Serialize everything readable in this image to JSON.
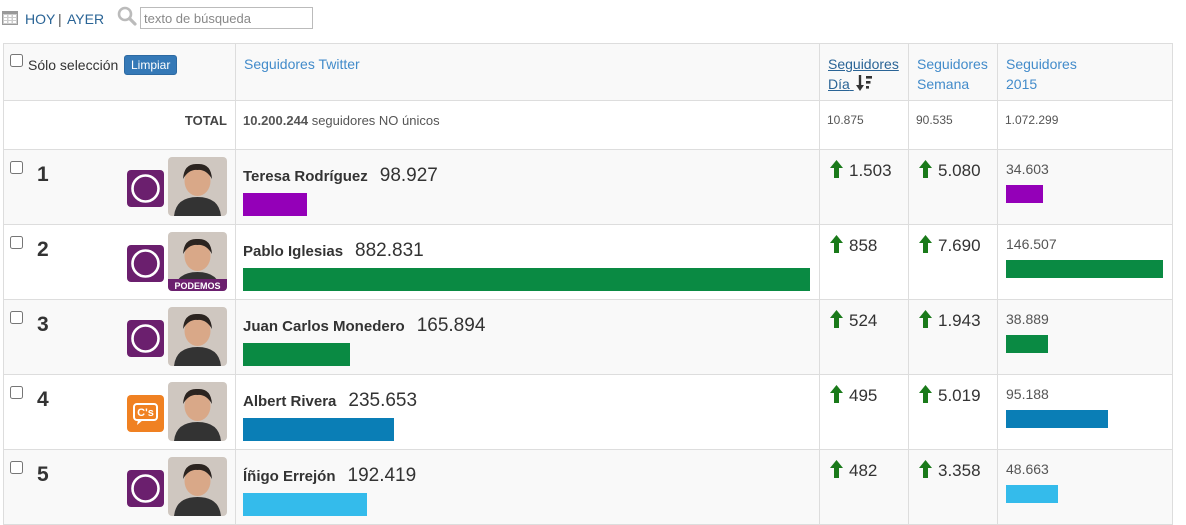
{
  "nav": {
    "today": "HOY",
    "separator": "|",
    "yesterday": "AYER"
  },
  "search": {
    "placeholder": "texto de búsqueda",
    "value": ""
  },
  "header": {
    "select_only": "Sólo selección",
    "clear_button": "Limpiar",
    "twitter": "Seguidores Twitter",
    "day_line1": "Seguidores",
    "day_line2": "Día",
    "week_line1": "Seguidores",
    "week_line2": "Semana",
    "y2015_line1": "Seguidores",
    "y2015_line2": "2015"
  },
  "total": {
    "label": "TOTAL",
    "followers": "10.200.244",
    "followers_suffix": "seguidores NO únicos",
    "day": "10.875",
    "week": "90.535",
    "y2015": "1.072.299"
  },
  "colors": {
    "purple": "#9400b8",
    "green": "#0a8a43",
    "blue": "#0a7eb6",
    "cyan": "#34bbeb",
    "up_arrow": "#1a7a1a",
    "podemos": "#6b1f6e",
    "cs": "#f08122"
  },
  "rows": [
    {
      "rank": "1",
      "name": "Teresa Rodríguez",
      "followers": "98.927",
      "followers_num": 98927,
      "party": "podemos-logo-icon",
      "bar_color": "#9400b8",
      "day": "1.503",
      "week": "5.080",
      "y2015": "34.603",
      "y2015_num": 34603
    },
    {
      "rank": "2",
      "name": "Pablo Iglesias",
      "followers": "882.831",
      "followers_num": 882831,
      "party": "podemos-logo-icon",
      "avatar_text": "PODEMOS",
      "bar_color": "#0a8a43",
      "day": "858",
      "week": "7.690",
      "y2015": "146.507",
      "y2015_num": 146507
    },
    {
      "rank": "3",
      "name": "Juan Carlos Monedero",
      "followers": "165.894",
      "followers_num": 165894,
      "party": "podemos-logo-icon",
      "bar_color": "#0a8a43",
      "day": "524",
      "week": "1.943",
      "y2015": "38.889",
      "y2015_num": 38889
    },
    {
      "rank": "4",
      "name": "Albert Rivera",
      "followers": "235.653",
      "followers_num": 235653,
      "party": "ciudadanos-logo-icon",
      "party_text": "C's",
      "bar_color": "#0a7eb6",
      "day": "495",
      "week": "5.019",
      "y2015": "95.188",
      "y2015_num": 95188
    },
    {
      "rank": "5",
      "name": "Íñigo Errejón",
      "followers": "192.419",
      "followers_num": 192419,
      "party": "podemos-logo-icon",
      "bar_color": "#34bbeb",
      "day": "482",
      "week": "3.358",
      "y2015": "48.663",
      "y2015_num": 48663
    }
  ]
}
